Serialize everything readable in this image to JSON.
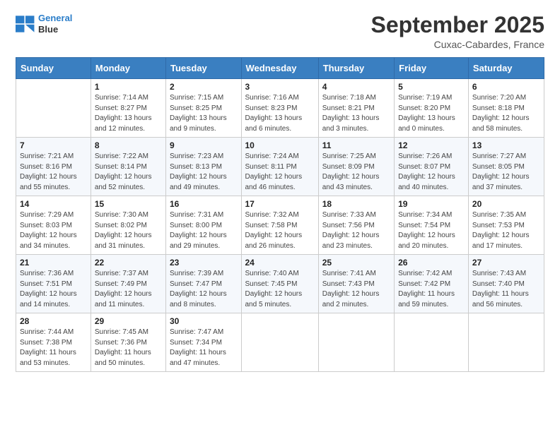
{
  "header": {
    "logo_line1": "General",
    "logo_line2": "Blue",
    "title": "September 2025",
    "location": "Cuxac-Cabardes, France"
  },
  "days_of_week": [
    "Sunday",
    "Monday",
    "Tuesday",
    "Wednesday",
    "Thursday",
    "Friday",
    "Saturday"
  ],
  "weeks": [
    [
      {
        "day": "",
        "sunrise": "",
        "sunset": "",
        "daylight": ""
      },
      {
        "day": "1",
        "sunrise": "Sunrise: 7:14 AM",
        "sunset": "Sunset: 8:27 PM",
        "daylight": "Daylight: 13 hours and 12 minutes."
      },
      {
        "day": "2",
        "sunrise": "Sunrise: 7:15 AM",
        "sunset": "Sunset: 8:25 PM",
        "daylight": "Daylight: 13 hours and 9 minutes."
      },
      {
        "day": "3",
        "sunrise": "Sunrise: 7:16 AM",
        "sunset": "Sunset: 8:23 PM",
        "daylight": "Daylight: 13 hours and 6 minutes."
      },
      {
        "day": "4",
        "sunrise": "Sunrise: 7:18 AM",
        "sunset": "Sunset: 8:21 PM",
        "daylight": "Daylight: 13 hours and 3 minutes."
      },
      {
        "day": "5",
        "sunrise": "Sunrise: 7:19 AM",
        "sunset": "Sunset: 8:20 PM",
        "daylight": "Daylight: 13 hours and 0 minutes."
      },
      {
        "day": "6",
        "sunrise": "Sunrise: 7:20 AM",
        "sunset": "Sunset: 8:18 PM",
        "daylight": "Daylight: 12 hours and 58 minutes."
      }
    ],
    [
      {
        "day": "7",
        "sunrise": "Sunrise: 7:21 AM",
        "sunset": "Sunset: 8:16 PM",
        "daylight": "Daylight: 12 hours and 55 minutes."
      },
      {
        "day": "8",
        "sunrise": "Sunrise: 7:22 AM",
        "sunset": "Sunset: 8:14 PM",
        "daylight": "Daylight: 12 hours and 52 minutes."
      },
      {
        "day": "9",
        "sunrise": "Sunrise: 7:23 AM",
        "sunset": "Sunset: 8:13 PM",
        "daylight": "Daylight: 12 hours and 49 minutes."
      },
      {
        "day": "10",
        "sunrise": "Sunrise: 7:24 AM",
        "sunset": "Sunset: 8:11 PM",
        "daylight": "Daylight: 12 hours and 46 minutes."
      },
      {
        "day": "11",
        "sunrise": "Sunrise: 7:25 AM",
        "sunset": "Sunset: 8:09 PM",
        "daylight": "Daylight: 12 hours and 43 minutes."
      },
      {
        "day": "12",
        "sunrise": "Sunrise: 7:26 AM",
        "sunset": "Sunset: 8:07 PM",
        "daylight": "Daylight: 12 hours and 40 minutes."
      },
      {
        "day": "13",
        "sunrise": "Sunrise: 7:27 AM",
        "sunset": "Sunset: 8:05 PM",
        "daylight": "Daylight: 12 hours and 37 minutes."
      }
    ],
    [
      {
        "day": "14",
        "sunrise": "Sunrise: 7:29 AM",
        "sunset": "Sunset: 8:03 PM",
        "daylight": "Daylight: 12 hours and 34 minutes."
      },
      {
        "day": "15",
        "sunrise": "Sunrise: 7:30 AM",
        "sunset": "Sunset: 8:02 PM",
        "daylight": "Daylight: 12 hours and 31 minutes."
      },
      {
        "day": "16",
        "sunrise": "Sunrise: 7:31 AM",
        "sunset": "Sunset: 8:00 PM",
        "daylight": "Daylight: 12 hours and 29 minutes."
      },
      {
        "day": "17",
        "sunrise": "Sunrise: 7:32 AM",
        "sunset": "Sunset: 7:58 PM",
        "daylight": "Daylight: 12 hours and 26 minutes."
      },
      {
        "day": "18",
        "sunrise": "Sunrise: 7:33 AM",
        "sunset": "Sunset: 7:56 PM",
        "daylight": "Daylight: 12 hours and 23 minutes."
      },
      {
        "day": "19",
        "sunrise": "Sunrise: 7:34 AM",
        "sunset": "Sunset: 7:54 PM",
        "daylight": "Daylight: 12 hours and 20 minutes."
      },
      {
        "day": "20",
        "sunrise": "Sunrise: 7:35 AM",
        "sunset": "Sunset: 7:53 PM",
        "daylight": "Daylight: 12 hours and 17 minutes."
      }
    ],
    [
      {
        "day": "21",
        "sunrise": "Sunrise: 7:36 AM",
        "sunset": "Sunset: 7:51 PM",
        "daylight": "Daylight: 12 hours and 14 minutes."
      },
      {
        "day": "22",
        "sunrise": "Sunrise: 7:37 AM",
        "sunset": "Sunset: 7:49 PM",
        "daylight": "Daylight: 12 hours and 11 minutes."
      },
      {
        "day": "23",
        "sunrise": "Sunrise: 7:39 AM",
        "sunset": "Sunset: 7:47 PM",
        "daylight": "Daylight: 12 hours and 8 minutes."
      },
      {
        "day": "24",
        "sunrise": "Sunrise: 7:40 AM",
        "sunset": "Sunset: 7:45 PM",
        "daylight": "Daylight: 12 hours and 5 minutes."
      },
      {
        "day": "25",
        "sunrise": "Sunrise: 7:41 AM",
        "sunset": "Sunset: 7:43 PM",
        "daylight": "Daylight: 12 hours and 2 minutes."
      },
      {
        "day": "26",
        "sunrise": "Sunrise: 7:42 AM",
        "sunset": "Sunset: 7:42 PM",
        "daylight": "Daylight: 11 hours and 59 minutes."
      },
      {
        "day": "27",
        "sunrise": "Sunrise: 7:43 AM",
        "sunset": "Sunset: 7:40 PM",
        "daylight": "Daylight: 11 hours and 56 minutes."
      }
    ],
    [
      {
        "day": "28",
        "sunrise": "Sunrise: 7:44 AM",
        "sunset": "Sunset: 7:38 PM",
        "daylight": "Daylight: 11 hours and 53 minutes."
      },
      {
        "day": "29",
        "sunrise": "Sunrise: 7:45 AM",
        "sunset": "Sunset: 7:36 PM",
        "daylight": "Daylight: 11 hours and 50 minutes."
      },
      {
        "day": "30",
        "sunrise": "Sunrise: 7:47 AM",
        "sunset": "Sunset: 7:34 PM",
        "daylight": "Daylight: 11 hours and 47 minutes."
      },
      {
        "day": "",
        "sunrise": "",
        "sunset": "",
        "daylight": ""
      },
      {
        "day": "",
        "sunrise": "",
        "sunset": "",
        "daylight": ""
      },
      {
        "day": "",
        "sunrise": "",
        "sunset": "",
        "daylight": ""
      },
      {
        "day": "",
        "sunrise": "",
        "sunset": "",
        "daylight": ""
      }
    ]
  ]
}
